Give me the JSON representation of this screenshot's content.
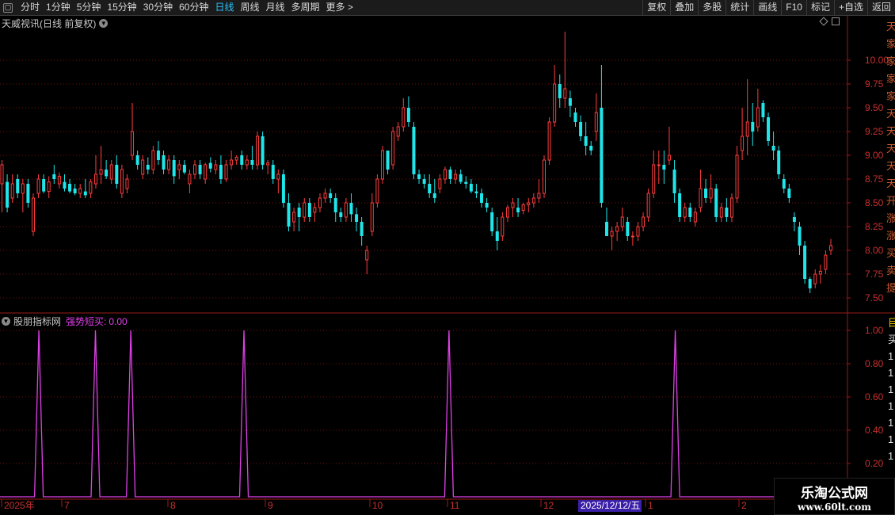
{
  "toolbar": {
    "left_items": [
      "分时",
      "1分钟",
      "5分钟",
      "15分钟",
      "30分钟",
      "60分钟",
      "日线",
      "周线",
      "月线",
      "多周期",
      "更多 >"
    ],
    "active_index": 6,
    "right_items": [
      "复权",
      "叠加",
      "多股",
      "统计",
      "画线",
      "F10",
      "标记",
      "+自选",
      "返回"
    ]
  },
  "main_panel": {
    "title": "天威视讯(日线 前复权)",
    "y_ticks": [
      "10.00",
      "9.75",
      "9.50",
      "9.25",
      "9.00",
      "8.75",
      "8.50",
      "8.25",
      "8.00",
      "7.75",
      "7.50"
    ],
    "side_text": "天家家家家天天天天天开涨涨买卖提示"
  },
  "indicator_panel": {
    "title": "股朋指标网",
    "indicator_label": "强势短买:",
    "indicator_value": "0.00",
    "y_ticks": [
      "1.00",
      "0.80",
      "0.60",
      "0.40",
      "0.20"
    ],
    "side_text": "目买1111111"
  },
  "x_axis": {
    "labels": [
      "2025年",
      "7",
      "8",
      "9",
      "10",
      "11",
      "12",
      "1",
      "2"
    ],
    "crosshair_date": "2025/12/12/五"
  },
  "watermark": {
    "line1": "乐淘公式网",
    "line2": "www.60lt.com"
  },
  "colors": {
    "up": "#ff3d3d",
    "down": "#1fe6ea",
    "indicator": "#e040e8",
    "grid": "#7a1010",
    "axis": "#9a1a1a"
  },
  "chart_data": [
    {
      "type": "candlestick",
      "title": "天威视讯(日线 前复权)",
      "y_range": [
        7.4,
        10.4
      ],
      "candles": [
        {
          "o": 8.7,
          "h": 8.95,
          "l": 8.4,
          "c": 8.9
        },
        {
          "o": 8.72,
          "h": 8.8,
          "l": 8.4,
          "c": 8.45
        },
        {
          "o": 8.55,
          "h": 8.8,
          "l": 8.5,
          "c": 8.7
        },
        {
          "o": 8.75,
          "h": 8.8,
          "l": 8.55,
          "c": 8.6
        },
        {
          "o": 8.6,
          "h": 8.75,
          "l": 8.4,
          "c": 8.7
        },
        {
          "o": 8.7,
          "h": 8.75,
          "l": 8.45,
          "c": 8.5
        },
        {
          "o": 8.2,
          "h": 8.6,
          "l": 8.15,
          "c": 8.55
        },
        {
          "o": 8.6,
          "h": 8.8,
          "l": 8.55,
          "c": 8.75
        },
        {
          "o": 8.75,
          "h": 8.8,
          "l": 8.6,
          "c": 8.62
        },
        {
          "o": 8.62,
          "h": 8.78,
          "l": 8.55,
          "c": 8.72
        },
        {
          "o": 8.8,
          "h": 8.9,
          "l": 8.7,
          "c": 8.75
        },
        {
          "o": 8.7,
          "h": 8.82,
          "l": 8.65,
          "c": 8.78
        },
        {
          "o": 8.72,
          "h": 8.8,
          "l": 8.62,
          "c": 8.65
        },
        {
          "o": 8.7,
          "h": 8.75,
          "l": 8.6,
          "c": 8.62
        },
        {
          "o": 8.65,
          "h": 8.7,
          "l": 8.58,
          "c": 8.6
        },
        {
          "o": 8.6,
          "h": 8.7,
          "l": 8.55,
          "c": 8.65
        },
        {
          "o": 8.62,
          "h": 8.75,
          "l": 8.55,
          "c": 8.58
        },
        {
          "o": 8.6,
          "h": 8.75,
          "l": 8.55,
          "c": 8.72
        },
        {
          "o": 8.7,
          "h": 9.0,
          "l": 8.65,
          "c": 8.8
        },
        {
          "o": 8.8,
          "h": 9.1,
          "l": 8.7,
          "c": 8.85
        },
        {
          "o": 8.85,
          "h": 8.95,
          "l": 8.75,
          "c": 8.78
        },
        {
          "o": 8.75,
          "h": 8.95,
          "l": 8.7,
          "c": 8.9
        },
        {
          "o": 8.9,
          "h": 9.0,
          "l": 8.65,
          "c": 8.7
        },
        {
          "o": 8.6,
          "h": 8.9,
          "l": 8.55,
          "c": 8.85
        },
        {
          "o": 8.65,
          "h": 8.8,
          "l": 8.6,
          "c": 8.75
        },
        {
          "o": 9.0,
          "h": 9.55,
          "l": 8.95,
          "c": 9.25
        },
        {
          "o": 9.0,
          "h": 9.05,
          "l": 8.85,
          "c": 8.9
        },
        {
          "o": 8.8,
          "h": 9.0,
          "l": 8.75,
          "c": 8.95
        },
        {
          "o": 8.9,
          "h": 8.98,
          "l": 8.8,
          "c": 8.85
        },
        {
          "o": 8.85,
          "h": 9.1,
          "l": 8.8,
          "c": 9.05
        },
        {
          "o": 9.05,
          "h": 9.15,
          "l": 8.9,
          "c": 8.95
        },
        {
          "o": 9.0,
          "h": 9.05,
          "l": 8.8,
          "c": 8.85
        },
        {
          "o": 8.85,
          "h": 9.0,
          "l": 8.8,
          "c": 8.95
        },
        {
          "o": 8.95,
          "h": 9.0,
          "l": 8.7,
          "c": 8.78
        },
        {
          "o": 8.85,
          "h": 8.95,
          "l": 8.75,
          "c": 8.9
        },
        {
          "o": 8.9,
          "h": 8.95,
          "l": 8.8,
          "c": 8.82
        },
        {
          "o": 8.7,
          "h": 8.85,
          "l": 8.6,
          "c": 8.8
        },
        {
          "o": 8.8,
          "h": 8.95,
          "l": 8.75,
          "c": 8.9
        },
        {
          "o": 8.9,
          "h": 8.95,
          "l": 8.75,
          "c": 8.8
        },
        {
          "o": 8.75,
          "h": 8.92,
          "l": 8.7,
          "c": 8.9
        },
        {
          "o": 8.92,
          "h": 8.98,
          "l": 8.82,
          "c": 8.86
        },
        {
          "o": 8.85,
          "h": 8.95,
          "l": 8.8,
          "c": 8.9
        },
        {
          "o": 8.9,
          "h": 9.0,
          "l": 8.7,
          "c": 8.75
        },
        {
          "o": 8.75,
          "h": 8.95,
          "l": 8.72,
          "c": 8.9
        },
        {
          "o": 8.9,
          "h": 9.05,
          "l": 8.85,
          "c": 8.95
        },
        {
          "o": 8.95,
          "h": 9.0,
          "l": 8.9,
          "c": 8.98
        },
        {
          "o": 9.0,
          "h": 9.05,
          "l": 8.85,
          "c": 8.9
        },
        {
          "o": 8.9,
          "h": 9.0,
          "l": 8.85,
          "c": 8.95
        },
        {
          "o": 8.95,
          "h": 9.1,
          "l": 8.85,
          "c": 8.9
        },
        {
          "o": 8.9,
          "h": 9.25,
          "l": 8.85,
          "c": 9.2
        },
        {
          "o": 9.2,
          "h": 9.25,
          "l": 8.85,
          "c": 8.9
        },
        {
          "o": 8.9,
          "h": 8.95,
          "l": 8.8,
          "c": 8.92
        },
        {
          "o": 8.9,
          "h": 8.95,
          "l": 8.7,
          "c": 8.75
        },
        {
          "o": 8.75,
          "h": 8.85,
          "l": 8.6,
          "c": 8.8
        },
        {
          "o": 8.8,
          "h": 8.85,
          "l": 8.45,
          "c": 8.5
        },
        {
          "o": 8.5,
          "h": 8.6,
          "l": 8.2,
          "c": 8.25
        },
        {
          "o": 8.3,
          "h": 8.45,
          "l": 8.2,
          "c": 8.4
        },
        {
          "o": 8.45,
          "h": 8.5,
          "l": 8.2,
          "c": 8.35
        },
        {
          "o": 8.35,
          "h": 8.55,
          "l": 8.3,
          "c": 8.5
        },
        {
          "o": 8.5,
          "h": 8.55,
          "l": 8.3,
          "c": 8.35
        },
        {
          "o": 8.4,
          "h": 8.5,
          "l": 8.3,
          "c": 8.45
        },
        {
          "o": 8.45,
          "h": 8.6,
          "l": 8.4,
          "c": 8.55
        },
        {
          "o": 8.55,
          "h": 8.65,
          "l": 8.5,
          "c": 8.6
        },
        {
          "o": 8.6,
          "h": 8.65,
          "l": 8.5,
          "c": 8.55
        },
        {
          "o": 8.55,
          "h": 8.6,
          "l": 8.3,
          "c": 8.4
        },
        {
          "o": 8.4,
          "h": 8.45,
          "l": 8.3,
          "c": 8.35
        },
        {
          "o": 8.35,
          "h": 8.55,
          "l": 8.3,
          "c": 8.5
        },
        {
          "o": 8.5,
          "h": 8.6,
          "l": 8.3,
          "c": 8.38
        },
        {
          "o": 8.38,
          "h": 8.45,
          "l": 8.2,
          "c": 8.3
        },
        {
          "o": 8.3,
          "h": 8.35,
          "l": 8.05,
          "c": 8.15
        },
        {
          "o": 7.9,
          "h": 8.05,
          "l": 7.75,
          "c": 8.0
        },
        {
          "o": 8.2,
          "h": 8.6,
          "l": 8.15,
          "c": 8.5
        },
        {
          "o": 8.5,
          "h": 8.8,
          "l": 8.45,
          "c": 8.75
        },
        {
          "o": 8.75,
          "h": 9.1,
          "l": 8.7,
          "c": 9.05
        },
        {
          "o": 9.05,
          "h": 9.05,
          "l": 8.8,
          "c": 8.85
        },
        {
          "o": 8.9,
          "h": 9.3,
          "l": 8.85,
          "c": 9.25
        },
        {
          "o": 9.2,
          "h": 9.35,
          "l": 9.15,
          "c": 9.3
        },
        {
          "o": 9.3,
          "h": 9.6,
          "l": 9.25,
          "c": 9.5
        },
        {
          "o": 9.5,
          "h": 9.62,
          "l": 9.3,
          "c": 9.35
        },
        {
          "o": 9.3,
          "h": 9.35,
          "l": 8.75,
          "c": 8.8
        },
        {
          "o": 8.8,
          "h": 8.85,
          "l": 8.7,
          "c": 8.75
        },
        {
          "o": 8.75,
          "h": 8.8,
          "l": 8.65,
          "c": 8.7
        },
        {
          "o": 8.7,
          "h": 8.8,
          "l": 8.55,
          "c": 8.6
        },
        {
          "o": 8.6,
          "h": 8.75,
          "l": 8.5,
          "c": 8.55
        },
        {
          "o": 8.65,
          "h": 8.8,
          "l": 8.6,
          "c": 8.75
        },
        {
          "o": 8.75,
          "h": 8.88,
          "l": 8.7,
          "c": 8.85
        },
        {
          "o": 8.85,
          "h": 8.88,
          "l": 8.7,
          "c": 8.75
        },
        {
          "o": 8.75,
          "h": 8.85,
          "l": 8.7,
          "c": 8.8
        },
        {
          "o": 8.8,
          "h": 8.85,
          "l": 8.7,
          "c": 8.72
        },
        {
          "o": 8.72,
          "h": 8.78,
          "l": 8.65,
          "c": 8.7
        },
        {
          "o": 8.7,
          "h": 8.75,
          "l": 8.6,
          "c": 8.62
        },
        {
          "o": 8.62,
          "h": 8.7,
          "l": 8.55,
          "c": 8.6
        },
        {
          "o": 8.6,
          "h": 8.65,
          "l": 8.45,
          "c": 8.5
        },
        {
          "o": 8.5,
          "h": 8.55,
          "l": 8.4,
          "c": 8.45
        },
        {
          "o": 8.4,
          "h": 8.45,
          "l": 8.15,
          "c": 8.2
        },
        {
          "o": 8.2,
          "h": 8.35,
          "l": 8.0,
          "c": 8.1
        },
        {
          "o": 8.15,
          "h": 8.4,
          "l": 8.1,
          "c": 8.35
        },
        {
          "o": 8.35,
          "h": 8.48,
          "l": 8.3,
          "c": 8.45
        },
        {
          "o": 8.45,
          "h": 8.55,
          "l": 8.35,
          "c": 8.5
        },
        {
          "o": 8.45,
          "h": 8.55,
          "l": 8.35,
          "c": 8.4
        },
        {
          "o": 8.42,
          "h": 8.5,
          "l": 8.38,
          "c": 8.48
        },
        {
          "o": 8.48,
          "h": 8.55,
          "l": 8.4,
          "c": 8.5
        },
        {
          "o": 8.5,
          "h": 8.6,
          "l": 8.45,
          "c": 8.55
        },
        {
          "o": 8.55,
          "h": 8.75,
          "l": 8.5,
          "c": 8.6
        },
        {
          "o": 8.6,
          "h": 9.0,
          "l": 8.55,
          "c": 8.95
        },
        {
          "o": 8.95,
          "h": 9.4,
          "l": 8.9,
          "c": 9.35
        },
        {
          "o": 9.35,
          "h": 9.95,
          "l": 9.3,
          "c": 9.75
        },
        {
          "o": 9.75,
          "h": 9.85,
          "l": 9.5,
          "c": 9.6
        },
        {
          "o": 9.6,
          "h": 10.3,
          "l": 9.5,
          "c": 9.7
        },
        {
          "o": 9.6,
          "h": 9.68,
          "l": 9.4,
          "c": 9.52
        },
        {
          "o": 9.45,
          "h": 9.5,
          "l": 9.3,
          "c": 9.35
        },
        {
          "o": 9.35,
          "h": 9.42,
          "l": 9.15,
          "c": 9.2
        },
        {
          "o": 9.2,
          "h": 9.35,
          "l": 9.0,
          "c": 9.1
        },
        {
          "o": 9.1,
          "h": 9.15,
          "l": 9.0,
          "c": 9.05
        },
        {
          "o": 9.25,
          "h": 9.65,
          "l": 9.15,
          "c": 9.45
        },
        {
          "o": 9.5,
          "h": 9.95,
          "l": 8.45,
          "c": 8.5
        },
        {
          "o": 8.3,
          "h": 8.45,
          "l": 8.15,
          "c": 8.15
        },
        {
          "o": 8.15,
          "h": 8.25,
          "l": 8.0,
          "c": 8.2
        },
        {
          "o": 8.2,
          "h": 8.3,
          "l": 8.1,
          "c": 8.25
        },
        {
          "o": 8.25,
          "h": 8.45,
          "l": 8.2,
          "c": 8.35
        },
        {
          "o": 8.3,
          "h": 8.35,
          "l": 8.1,
          "c": 8.15
        },
        {
          "o": 8.15,
          "h": 8.2,
          "l": 8.05,
          "c": 8.15
        },
        {
          "o": 8.15,
          "h": 8.3,
          "l": 8.1,
          "c": 8.25
        },
        {
          "o": 8.25,
          "h": 8.4,
          "l": 8.2,
          "c": 8.35
        },
        {
          "o": 8.35,
          "h": 8.65,
          "l": 8.3,
          "c": 8.6
        },
        {
          "o": 8.6,
          "h": 9.05,
          "l": 8.55,
          "c": 8.9
        },
        {
          "o": 8.9,
          "h": 9.05,
          "l": 8.7,
          "c": 8.9
        },
        {
          "o": 8.9,
          "h": 9.05,
          "l": 8.7,
          "c": 8.85
        },
        {
          "o": 8.95,
          "h": 9.3,
          "l": 8.9,
          "c": 9.0
        },
        {
          "o": 8.85,
          "h": 8.95,
          "l": 8.5,
          "c": 8.6
        },
        {
          "o": 8.6,
          "h": 8.65,
          "l": 8.3,
          "c": 8.35
        },
        {
          "o": 8.35,
          "h": 8.5,
          "l": 8.3,
          "c": 8.45
        },
        {
          "o": 8.45,
          "h": 8.5,
          "l": 8.3,
          "c": 8.35
        },
        {
          "o": 8.3,
          "h": 8.45,
          "l": 8.25,
          "c": 8.4
        },
        {
          "o": 8.45,
          "h": 8.85,
          "l": 8.4,
          "c": 8.65
        },
        {
          "o": 8.65,
          "h": 8.75,
          "l": 8.5,
          "c": 8.55
        },
        {
          "o": 8.55,
          "h": 8.8,
          "l": 8.5,
          "c": 8.65
        },
        {
          "o": 8.65,
          "h": 8.7,
          "l": 8.3,
          "c": 8.35
        },
        {
          "o": 8.35,
          "h": 8.5,
          "l": 8.3,
          "c": 8.45
        },
        {
          "o": 8.45,
          "h": 8.55,
          "l": 8.3,
          "c": 8.35
        },
        {
          "o": 8.35,
          "h": 8.6,
          "l": 8.3,
          "c": 8.55
        },
        {
          "o": 8.55,
          "h": 9.1,
          "l": 8.5,
          "c": 9.0
        },
        {
          "o": 9.05,
          "h": 9.5,
          "l": 8.95,
          "c": 9.2
        },
        {
          "o": 9.2,
          "h": 9.8,
          "l": 9.0,
          "c": 9.35
        },
        {
          "o": 9.35,
          "h": 9.55,
          "l": 9.1,
          "c": 9.25
        },
        {
          "o": 9.3,
          "h": 9.7,
          "l": 9.25,
          "c": 9.5
        },
        {
          "o": 9.55,
          "h": 9.58,
          "l": 9.35,
          "c": 9.4
        },
        {
          "o": 9.4,
          "h": 9.45,
          "l": 9.1,
          "c": 9.15
        },
        {
          "o": 9.1,
          "h": 9.25,
          "l": 8.95,
          "c": 9.05
        },
        {
          "o": 9.05,
          "h": 9.1,
          "l": 8.75,
          "c": 8.8
        },
        {
          "o": 8.75,
          "h": 8.8,
          "l": 8.6,
          "c": 8.65
        },
        {
          "o": 8.65,
          "h": 8.7,
          "l": 8.5,
          "c": 8.55
        },
        {
          "o": 8.35,
          "h": 8.4,
          "l": 8.2,
          "c": 8.3
        },
        {
          "o": 8.25,
          "h": 8.3,
          "l": 7.95,
          "c": 8.05
        },
        {
          "o": 8.05,
          "h": 8.1,
          "l": 7.65,
          "c": 7.7
        },
        {
          "o": 7.7,
          "h": 7.72,
          "l": 7.55,
          "c": 7.6
        },
        {
          "o": 7.65,
          "h": 7.8,
          "l": 7.6,
          "c": 7.75
        },
        {
          "o": 7.75,
          "h": 7.85,
          "l": 7.65,
          "c": 7.78
        },
        {
          "o": 7.8,
          "h": 8.0,
          "l": 7.75,
          "c": 7.95
        },
        {
          "o": 8.0,
          "h": 8.12,
          "l": 7.95,
          "c": 8.05
        }
      ]
    },
    {
      "type": "line",
      "title": "股朋指标网",
      "series": [
        {
          "name": "强势短买",
          "spike_indices": [
            11,
            27,
            37,
            69,
            127,
            191
          ]
        }
      ],
      "length": 236,
      "ylim": [
        0,
        1.0
      ]
    }
  ]
}
